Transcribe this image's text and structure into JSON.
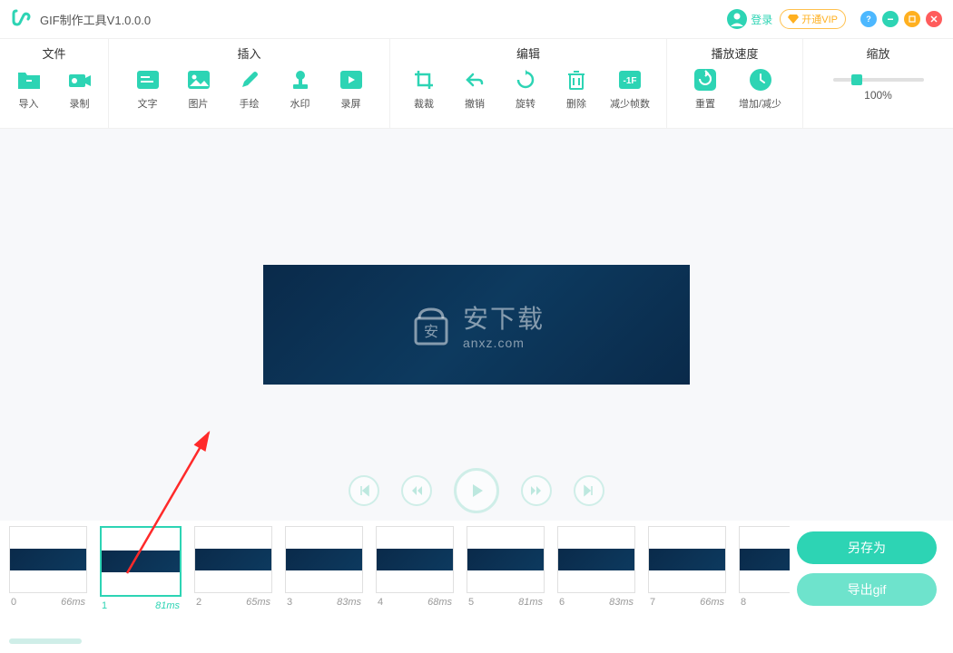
{
  "app": {
    "title": "GIF制作工具V1.0.0.0"
  },
  "header": {
    "login": "登录",
    "vip": "开通VIP"
  },
  "toolbar": {
    "file": {
      "title": "文件",
      "import": "导入",
      "record": "录制"
    },
    "insert": {
      "title": "插入",
      "text": "文字",
      "image": "图片",
      "draw": "手绘",
      "watermark": "水印",
      "screencap": "录屏"
    },
    "edit": {
      "title": "编辑",
      "crop": "裁裁",
      "undo": "撤销",
      "rotate": "旋转",
      "delete": "删除",
      "reduce": "减少帧数"
    },
    "speed": {
      "title": "播放速度",
      "reset": "重置",
      "adjust": "增加/减少"
    },
    "zoom": {
      "title": "缩放",
      "value": "100%"
    }
  },
  "preview": {
    "watermark_cn": "安下载",
    "watermark_en": "anxz.com",
    "bag_text": "安"
  },
  "frames": [
    {
      "index": "0",
      "duration": "66ms",
      "selected": false
    },
    {
      "index": "1",
      "duration": "81ms",
      "selected": true
    },
    {
      "index": "2",
      "duration": "65ms",
      "selected": false
    },
    {
      "index": "3",
      "duration": "83ms",
      "selected": false
    },
    {
      "index": "4",
      "duration": "68ms",
      "selected": false
    },
    {
      "index": "5",
      "duration": "81ms",
      "selected": false
    },
    {
      "index": "6",
      "duration": "83ms",
      "selected": false
    },
    {
      "index": "7",
      "duration": "66ms",
      "selected": false
    },
    {
      "index": "8",
      "duration": "",
      "selected": false
    }
  ],
  "actions": {
    "saveas": "另存为",
    "export": "导出gif"
  },
  "colors": {
    "accent": "#2dd4b4"
  }
}
